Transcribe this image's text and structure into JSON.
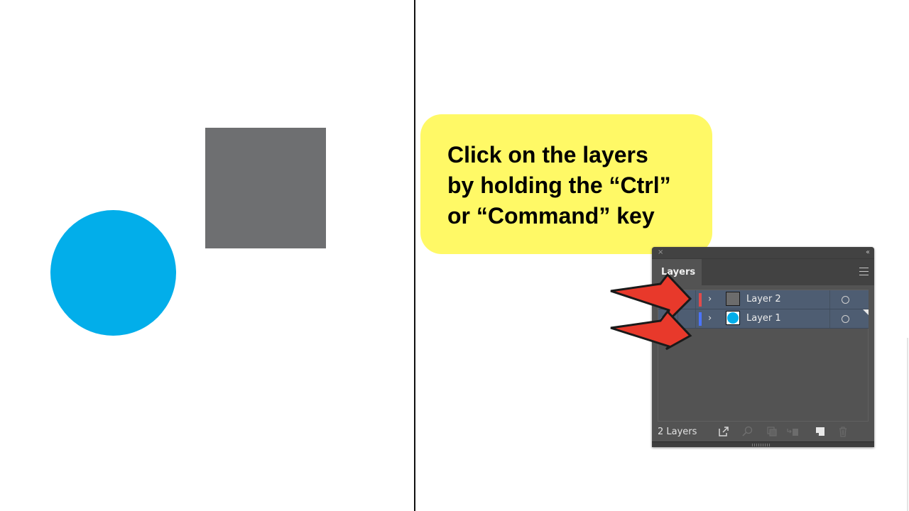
{
  "canvas": {
    "shapes": [
      {
        "type": "square",
        "color": "#6e6f71"
      },
      {
        "type": "circle",
        "color": "#02aeea"
      }
    ]
  },
  "callout": {
    "text": "Click on the layers\nby holding the “Ctrl”\nor “Command” key",
    "background": "#fff966"
  },
  "layers_panel": {
    "close_glyph": "×",
    "collapse_glyph": "‹‹",
    "tab_label": "Layers",
    "rows": [
      {
        "name": "Layer 2",
        "color": "#e14b4b",
        "thumbnail": "gray-square",
        "expand_glyph": "›",
        "selected": true
      },
      {
        "name": "Layer 1",
        "color": "#4b74ff",
        "thumbnail": "blue-circle",
        "expand_glyph": "›",
        "selected": true
      }
    ],
    "footer": {
      "count_label": "2 Layers",
      "icons": [
        "export-icon",
        "locate-object-icon",
        "clipping-mask-icon",
        "move-to-layer-icon",
        "new-layer-icon",
        "delete-icon"
      ]
    }
  },
  "annotations": {
    "arrow_color": "#e8392b",
    "arrows": [
      "arrow-to-layer-2",
      "arrow-to-layer-1"
    ]
  }
}
